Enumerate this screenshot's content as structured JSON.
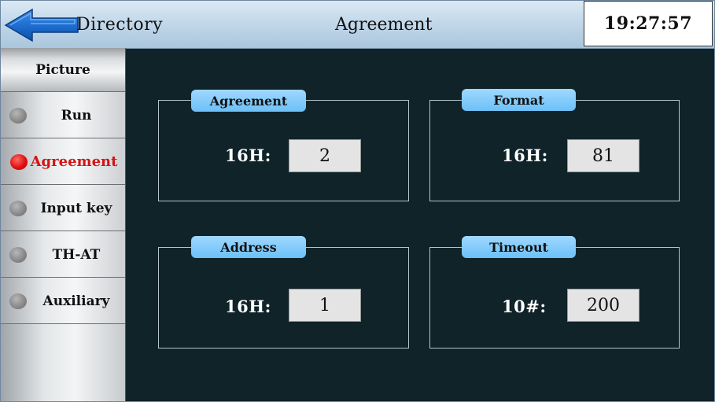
{
  "header": {
    "back_label": "Directory",
    "title": "Agreement",
    "clock": "19:27:57"
  },
  "sidebar": {
    "heading": "Picture",
    "items": [
      {
        "label": "Run",
        "active": false
      },
      {
        "label": "Agreement",
        "active": true
      },
      {
        "label": "Input key",
        "active": false
      },
      {
        "label": "TH-AT",
        "active": false
      },
      {
        "label": "Auxiliary",
        "active": false
      }
    ]
  },
  "panels": {
    "agreement": {
      "tag": "Agreement",
      "label": "16H:",
      "value": "2"
    },
    "format": {
      "tag": "Format",
      "label": "16H:",
      "value": "81"
    },
    "address": {
      "tag": "Address",
      "label": "16H:",
      "value": "1"
    },
    "timeout": {
      "tag": "Timeout",
      "label": "10#:",
      "value": "200"
    }
  },
  "colors": {
    "background": "#0f2329",
    "tag": "#7ac8f9",
    "active_indicator": "#e01010",
    "inactive_indicator": "#8a8a8a"
  }
}
